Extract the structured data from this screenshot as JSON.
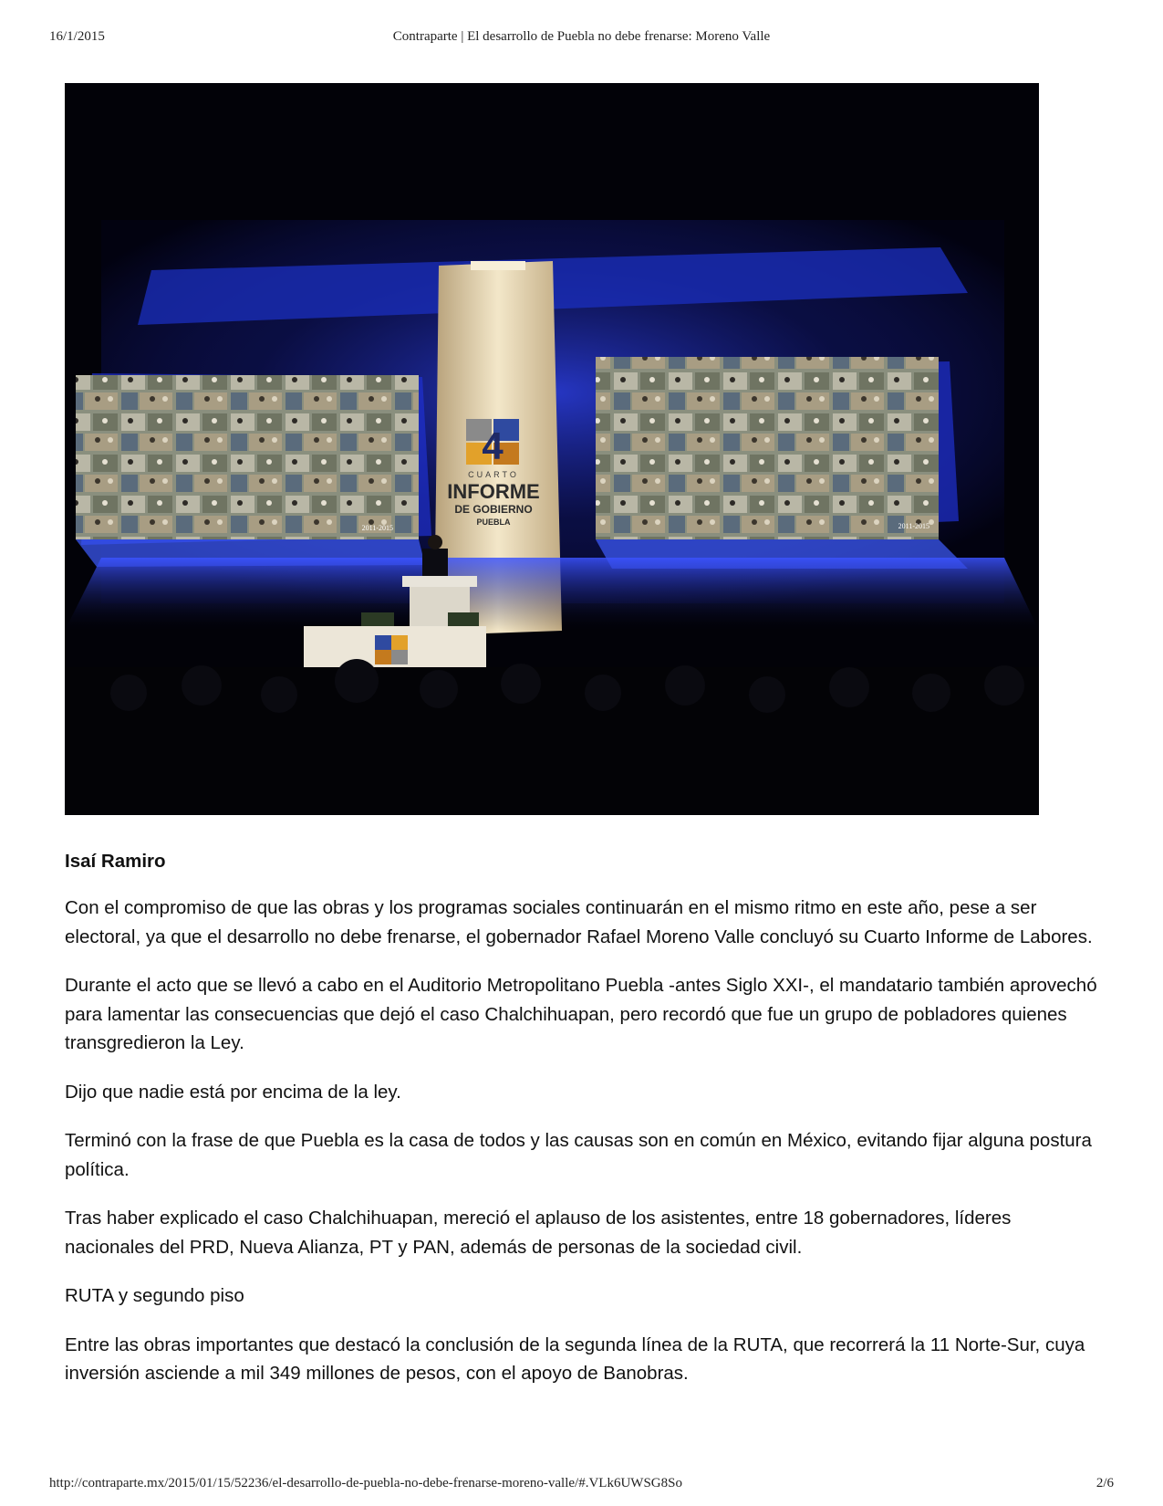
{
  "header": {
    "date": "16/1/2015",
    "title": "Contraparte | El desarrollo de Puebla no debe frenarse: Moreno Valle"
  },
  "photo": {
    "logo_number": "4",
    "logo_line1": "CUARTO",
    "logo_line2": "INFORME",
    "logo_line3": "DE GOBIERNO",
    "logo_line4": "PUEBLA",
    "screen_year": "2011-2015"
  },
  "article": {
    "author": "Isaí Ramiro",
    "paragraphs": [
      "Con el compromiso de que las obras y los programas sociales continuarán en el mismo ritmo en este año, pese a ser electoral, ya que el desarrollo no debe frenarse, el gobernador Rafael Moreno Valle concluyó su Cuarto Informe de Labores.",
      "Durante el acto que se llevó a cabo en el Auditorio Metropolitano Puebla -antes Siglo XXI-, el mandatario también aprovechó para lamentar las consecuencias que dejó el caso Chalchihuapan, pero recordó que fue un grupo de pobladores quienes transgredieron la Ley.",
      "Dijo que nadie está por encima de la ley.",
      "Terminó con la frase de que Puebla es la casa de todos y las causas son en común en México, evitando fijar alguna postura política.",
      "Tras haber explicado el caso Chalchihuapan, mereció el aplauso de los asistentes, entre 18 gobernadores, líderes nacionales del PRD, Nueva Alianza, PT y PAN, además de personas de la sociedad civil.",
      "RUTA y segundo piso",
      "Entre las obras importantes que destacó la conclusión de la segunda línea de la RUTA, que recorrerá la 11 Norte-Sur, cuya inversión asciende a mil 349 millones de pesos, con el apoyo de Banobras."
    ]
  },
  "footer": {
    "url": "http://contraparte.mx/2015/01/15/52236/el-desarrollo-de-puebla-no-debe-frenarse-moreno-valle/#.VLk6UWSG8So",
    "page": "2/6"
  }
}
